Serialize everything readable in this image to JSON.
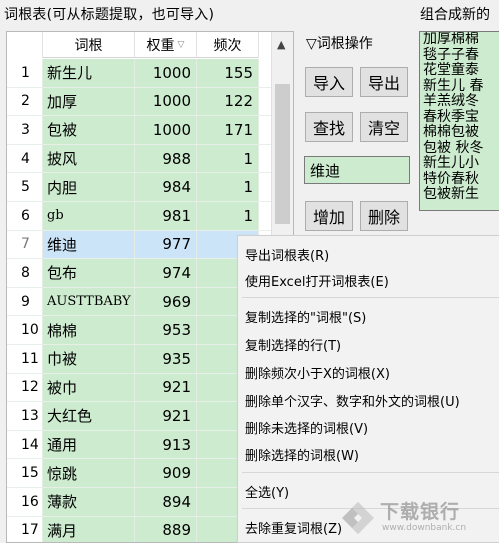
{
  "header": {
    "title": "词根表(可从标题提取，也可导入)",
    "right_title": "组合成新的"
  },
  "table": {
    "columns": {
      "word": "词根",
      "weight": "权重",
      "freq": "频次"
    },
    "sort_indicator": "▽",
    "rows": [
      {
        "idx": "1",
        "word": "新生儿",
        "weight": "1000",
        "freq": "155"
      },
      {
        "idx": "2",
        "word": "加厚",
        "weight": "1000",
        "freq": "122"
      },
      {
        "idx": "3",
        "word": "包被",
        "weight": "1000",
        "freq": "171"
      },
      {
        "idx": "4",
        "word": "披风",
        "weight": "988",
        "freq": "1"
      },
      {
        "idx": "5",
        "word": "内胆",
        "weight": "984",
        "freq": "1"
      },
      {
        "idx": "6",
        "word": "gb",
        "weight": "981",
        "freq": "1"
      },
      {
        "idx": "7",
        "word": "维迪",
        "weight": "977",
        "freq": ""
      },
      {
        "idx": "8",
        "word": "包布",
        "weight": "974",
        "freq": ""
      },
      {
        "idx": "9",
        "word": "AUSTTBABY",
        "weight": "969",
        "freq": ""
      },
      {
        "idx": "10",
        "word": "棉棉",
        "weight": "953",
        "freq": ""
      },
      {
        "idx": "11",
        "word": "巾被",
        "weight": "935",
        "freq": ""
      },
      {
        "idx": "12",
        "word": "被巾",
        "weight": "921",
        "freq": ""
      },
      {
        "idx": "13",
        "word": "大红色",
        "weight": "921",
        "freq": ""
      },
      {
        "idx": "14",
        "word": "通用",
        "weight": "913",
        "freq": ""
      },
      {
        "idx": "15",
        "word": "惊跳",
        "weight": "909",
        "freq": ""
      },
      {
        "idx": "16",
        "word": "薄款",
        "weight": "894",
        "freq": ""
      },
      {
        "idx": "17",
        "word": "满月",
        "weight": "889",
        "freq": ""
      }
    ],
    "selected_row": 7
  },
  "ops": {
    "label": "▽词根操作",
    "import_label": "导入",
    "export_label": "导出",
    "find_label": "查找",
    "clear_label": "清空",
    "input_value": "维迪",
    "add_label": "增加",
    "delete_label": "删除"
  },
  "combo_lines": [
    "加厚棉棉",
    "毯子子春",
    "花堂童泰",
    "新生儿 春",
    "羊羔绒冬",
    "春秋季宝",
    "棉棉包被",
    "包被 秋冬",
    "新生儿小",
    "特价春秋",
    "包被新生"
  ],
  "context_menu": {
    "export": "导出词根表(R)",
    "open_excel": "使用Excel打开词根表(E)",
    "copy_selected_words": "复制选择的\"词根\"(S)",
    "copy_selected_rows": "复制选择的行(T)",
    "delete_freq_less_x": "删除频次小于X的词根(X)",
    "delete_single_char": "删除单个汉字、数字和外文的词根(U)",
    "delete_unselected": "删除未选择的词根(V)",
    "delete_selected": "删除选择的词根(W)",
    "select_all": "全选(Y)",
    "dedupe": "去除重复词根(Z)"
  },
  "watermark": {
    "text": "下载银行",
    "sub": "www.downbank.cn"
  },
  "colors": {
    "cell_green": "#cdebcf",
    "selected_blue": "#cce4f7"
  }
}
